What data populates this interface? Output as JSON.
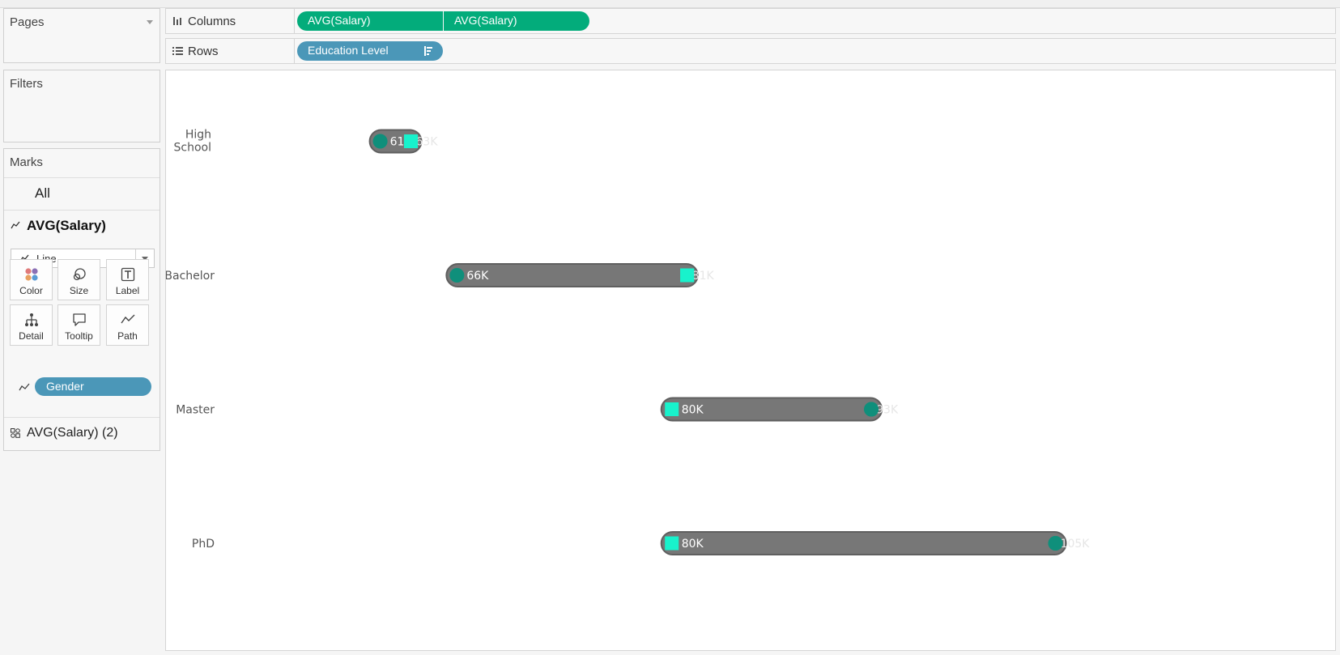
{
  "left_panel": {
    "pages_title": "Pages",
    "filters_title": "Filters",
    "marks": {
      "title": "Marks",
      "all_label": "All",
      "primary_layer": "AVG(Salary)",
      "mark_type": "Line",
      "buttons": [
        {
          "label": "Color",
          "icon": "color-icon"
        },
        {
          "label": "Size",
          "icon": "size-icon"
        },
        {
          "label": "Label",
          "icon": "label-icon"
        },
        {
          "label": "Detail",
          "icon": "detail-icon"
        },
        {
          "label": "Tooltip",
          "icon": "tooltip-icon"
        },
        {
          "label": "Path",
          "icon": "path-icon"
        }
      ],
      "path_field": "Gender",
      "secondary_layer": "AVG(Salary) (2)"
    }
  },
  "shelves": {
    "columns_label": "Columns",
    "columns_pills": [
      "AVG(Salary)",
      "AVG(Salary)"
    ],
    "rows_label": "Rows",
    "rows_pills": [
      "Education Level"
    ]
  },
  "colors": {
    "green_pill": "#03ac7b",
    "blue_pill": "#4b97b8",
    "bar_gray": "#777777",
    "dot_teal": "#0f8f7b",
    "square_aqua": "#18f2cc"
  },
  "chart_data": {
    "type": "dumbbell",
    "categories": [
      "High School",
      "Bachelor",
      "Master",
      "PhD"
    ],
    "xlim": [
      52,
      118
    ],
    "series": [
      {
        "marker": "circle",
        "values": [
          61,
          66,
          93,
          105
        ]
      },
      {
        "marker": "square",
        "values": [
          63,
          81,
          80,
          80
        ]
      }
    ],
    "labels": {
      "left": [
        "61K",
        "66K",
        "80K",
        "80K"
      ],
      "right_faint": [
        "63K",
        "81K",
        "93K",
        "105K"
      ]
    }
  }
}
